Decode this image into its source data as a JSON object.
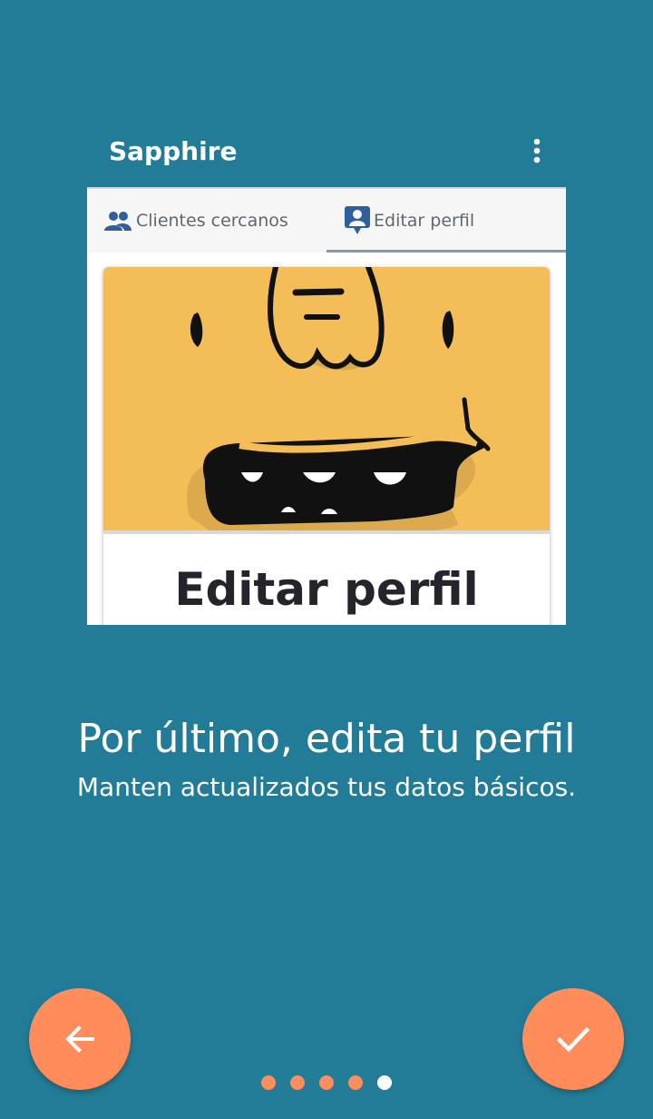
{
  "preview": {
    "app_title": "Sapphire",
    "tabs": [
      {
        "label": "Clientes cercanos",
        "icon": "people-icon",
        "selected": false
      },
      {
        "label": "Editar perfil",
        "icon": "account-box-icon",
        "selected": true
      }
    ],
    "card_title": "Editar perfil"
  },
  "headline": "Por último, edita tu perfil",
  "subtitle": "Manten actualizados tus datos básicos.",
  "navigation": {
    "back_icon": "arrow-back-icon",
    "done_icon": "check-icon",
    "page_count": 5,
    "current_page": 5
  },
  "colors": {
    "background": "#237c97",
    "accent": "#ff8c5a",
    "dot_active": "#ffffff",
    "dot_inactive": "#ff8c5a",
    "illustration_background": "#f3bd57"
  }
}
